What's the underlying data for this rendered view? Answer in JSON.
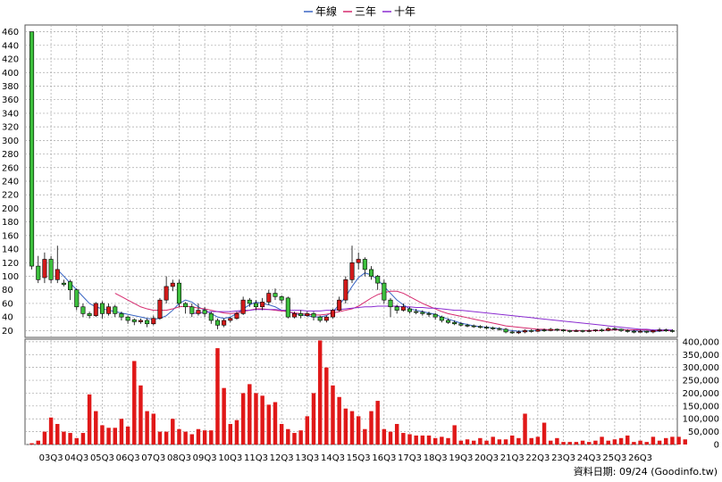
{
  "chart_data": {
    "type": "candlestick+bar",
    "legend": [
      {
        "label": "年線",
        "color": "#3a66c4"
      },
      {
        "label": "三年",
        "color": "#d62a6e"
      },
      {
        "label": "十年",
        "color": "#8a2bd0"
      }
    ],
    "price_axis": {
      "ticks": [
        20,
        40,
        60,
        80,
        100,
        120,
        140,
        160,
        180,
        200,
        220,
        240,
        260,
        280,
        300,
        320,
        340,
        360,
        380,
        400,
        420,
        440,
        460
      ],
      "ylim": [
        10,
        470
      ]
    },
    "volume_axis": {
      "tick_labels": [
        "400,000",
        "350,000",
        "300,000",
        "250,000",
        "200,000",
        "150,000",
        "100,000",
        "50,000",
        "0"
      ],
      "ylim": [
        0,
        410000
      ]
    },
    "x_tick_labels": [
      "03Q3",
      "04Q3",
      "05Q3",
      "06Q3",
      "07Q3",
      "08Q3",
      "09Q3",
      "10Q3",
      "11Q3",
      "12Q3",
      "13Q3",
      "14Q3",
      "15Q3",
      "16Q3",
      "17Q3",
      "18Q3",
      "19Q3",
      "20Q3",
      "21Q3",
      "22Q3",
      "23Q3",
      "24Q3",
      "25Q3",
      "26Q3"
    ],
    "x_tick_start_index": 3,
    "candles": [
      [
        460,
        115,
        460,
        110
      ],
      [
        115,
        95,
        130,
        90
      ],
      [
        98,
        125,
        135,
        90
      ],
      [
        125,
        95,
        130,
        90
      ],
      [
        95,
        110,
        145,
        90
      ],
      [
        90,
        88,
        95,
        85
      ],
      [
        92,
        80,
        95,
        65
      ],
      [
        80,
        55,
        82,
        50
      ],
      [
        55,
        45,
        60,
        40
      ],
      [
        45,
        42,
        48,
        38
      ],
      [
        42,
        60,
        62,
        40
      ],
      [
        60,
        45,
        63,
        38
      ],
      [
        45,
        55,
        60,
        42
      ],
      [
        55,
        45,
        58,
        40
      ],
      [
        45,
        40,
        48,
        35
      ],
      [
        40,
        35,
        42,
        30
      ],
      [
        36,
        33,
        38,
        28
      ],
      [
        33,
        35,
        38,
        30
      ],
      [
        35,
        30,
        38,
        25
      ],
      [
        30,
        38,
        42,
        28
      ],
      [
        38,
        65,
        68,
        36
      ],
      [
        65,
        85,
        100,
        60
      ],
      [
        85,
        90,
        95,
        78
      ],
      [
        90,
        60,
        95,
        55
      ],
      [
        60,
        55,
        62,
        45
      ],
      [
        55,
        45,
        60,
        40
      ],
      [
        45,
        50,
        60,
        42
      ],
      [
        50,
        45,
        55,
        40
      ],
      [
        45,
        35,
        48,
        30
      ],
      [
        35,
        28,
        38,
        22
      ],
      [
        28,
        35,
        38,
        25
      ],
      [
        35,
        38,
        40,
        32
      ],
      [
        38,
        45,
        48,
        36
      ],
      [
        45,
        65,
        70,
        43
      ],
      [
        65,
        60,
        68,
        55
      ],
      [
        60,
        55,
        65,
        50
      ],
      [
        55,
        62,
        68,
        50
      ],
      [
        62,
        75,
        80,
        58
      ],
      [
        75,
        70,
        82,
        65
      ],
      [
        70,
        65,
        72,
        60
      ],
      [
        68,
        40,
        70,
        38
      ],
      [
        40,
        45,
        48,
        38
      ],
      [
        45,
        42,
        50,
        38
      ],
      [
        42,
        45,
        48,
        40
      ],
      [
        45,
        40,
        48,
        35
      ],
      [
        40,
        35,
        42,
        32
      ],
      [
        35,
        40,
        42,
        32
      ],
      [
        40,
        50,
        52,
        38
      ],
      [
        50,
        65,
        70,
        48
      ],
      [
        65,
        95,
        100,
        60
      ],
      [
        95,
        120,
        145,
        90
      ],
      [
        120,
        125,
        135,
        110
      ],
      [
        125,
        110,
        128,
        100
      ],
      [
        110,
        100,
        115,
        95
      ],
      [
        100,
        90,
        102,
        80
      ],
      [
        90,
        65,
        95,
        60
      ],
      [
        65,
        55,
        68,
        40
      ],
      [
        55,
        50,
        58,
        45
      ],
      [
        50,
        55,
        60,
        48
      ],
      [
        52,
        48,
        55,
        45
      ],
      [
        48,
        47,
        52,
        44
      ],
      [
        47,
        45,
        50,
        42
      ],
      [
        45,
        44,
        48,
        40
      ],
      [
        44,
        40,
        46,
        36
      ],
      [
        40,
        35,
        42,
        32
      ],
      [
        35,
        32,
        38,
        30
      ],
      [
        32,
        30,
        35,
        28
      ],
      [
        30,
        28,
        32,
        26
      ],
      [
        28,
        27,
        30,
        25
      ],
      [
        27,
        26,
        29,
        24
      ],
      [
        26,
        25,
        28,
        23
      ],
      [
        25,
        24,
        27,
        22
      ],
      [
        24,
        23,
        26,
        21
      ],
      [
        23,
        22,
        25,
        20
      ],
      [
        22,
        18,
        24,
        16
      ],
      [
        18,
        17,
        20,
        15
      ],
      [
        17,
        18,
        20,
        15
      ],
      [
        18,
        20,
        22,
        16
      ],
      [
        20,
        19,
        22,
        17
      ],
      [
        19,
        21,
        23,
        18
      ],
      [
        21,
        20,
        23,
        18
      ],
      [
        20,
        22,
        24,
        19
      ],
      [
        22,
        21,
        23,
        19
      ],
      [
        21,
        20,
        22,
        18
      ],
      [
        20,
        19,
        21,
        17
      ],
      [
        19,
        20,
        22,
        18
      ],
      [
        20,
        19,
        21,
        17
      ],
      [
        19,
        20,
        22,
        18
      ],
      [
        20,
        21,
        22,
        18
      ],
      [
        21,
        20,
        23,
        18
      ],
      [
        20,
        23,
        25,
        19
      ],
      [
        23,
        22,
        25,
        20
      ],
      [
        22,
        20,
        23,
        18
      ],
      [
        20,
        19,
        22,
        17
      ],
      [
        19,
        18,
        21,
        16
      ],
      [
        18,
        19,
        21,
        17
      ],
      [
        19,
        18,
        20,
        16
      ],
      [
        18,
        20,
        21,
        16
      ],
      [
        20,
        21,
        24,
        18
      ],
      [
        21,
        20,
        23,
        18
      ],
      [
        20,
        19,
        22,
        17
      ]
    ],
    "volumes": [
      5000,
      15000,
      50000,
      105000,
      80000,
      50000,
      45000,
      25000,
      45000,
      195000,
      130000,
      75000,
      65000,
      65000,
      100000,
      70000,
      325000,
      230000,
      130000,
      120000,
      50000,
      50000,
      100000,
      60000,
      50000,
      40000,
      60000,
      55000,
      55000,
      375000,
      220000,
      80000,
      95000,
      200000,
      235000,
      200000,
      190000,
      155000,
      165000,
      80000,
      60000,
      45000,
      55000,
      110000,
      200000,
      405000,
      300000,
      230000,
      185000,
      140000,
      130000,
      110000,
      60000,
      130000,
      170000,
      60000,
      50000,
      80000,
      45000,
      40000,
      35000,
      35000,
      35000,
      25000,
      30000,
      25000,
      75000,
      15000,
      20000,
      15000,
      25000,
      15000,
      30000,
      20000,
      20000,
      35000,
      25000,
      120000,
      25000,
      30000,
      85000,
      15000,
      25000,
      10000,
      10000,
      10000,
      15000,
      10000,
      15000,
      30000,
      15000,
      20000,
      25000,
      35000,
      10000,
      15000,
      10000,
      30000,
      15000,
      25000,
      30000,
      30000,
      20000
    ],
    "ma_year": [
      null,
      null,
      null,
      null,
      110,
      100,
      90,
      80,
      70,
      60,
      55,
      52,
      50,
      48,
      46,
      44,
      42,
      40,
      38,
      37,
      38,
      42,
      50,
      60,
      65,
      62,
      55,
      50,
      45,
      40,
      38,
      40,
      45,
      52,
      58,
      62,
      60,
      58,
      55,
      50,
      48,
      45,
      43,
      42,
      40,
      40,
      42,
      48,
      58,
      70,
      85,
      98,
      105,
      102,
      95,
      85,
      75,
      65,
      58,
      52,
      50,
      48,
      46,
      44,
      40,
      37,
      34,
      31,
      29,
      27,
      26,
      25,
      24,
      23,
      21,
      20,
      19,
      19,
      20,
      20,
      21,
      21,
      21,
      21,
      20,
      20,
      20,
      20,
      20,
      20,
      21,
      22,
      22,
      21,
      20,
      19,
      19,
      19,
      19,
      20,
      20
    ],
    "ma_3y": [
      null,
      null,
      null,
      null,
      null,
      null,
      null,
      null,
      null,
      null,
      null,
      null,
      null,
      75,
      70,
      65,
      60,
      55,
      52,
      50,
      50,
      50,
      52,
      55,
      56,
      55,
      53,
      52,
      50,
      48,
      46,
      45,
      46,
      48,
      50,
      52,
      52,
      51,
      50,
      49,
      48,
      46,
      45,
      44,
      43,
      43,
      44,
      46,
      48,
      50,
      52,
      56,
      62,
      68,
      73,
      76,
      78,
      78,
      75,
      70,
      65,
      60,
      56,
      52,
      48,
      45,
      43,
      41,
      39,
      37,
      35,
      33,
      31,
      29,
      27,
      26,
      25,
      24,
      23,
      22,
      22,
      21,
      21,
      21,
      20,
      20,
      20,
      20,
      20,
      20,
      21,
      21,
      21,
      21,
      21,
      21,
      21,
      20,
      20,
      20,
      20
    ],
    "ma_10y": [
      null,
      null,
      null,
      null,
      null,
      null,
      null,
      null,
      null,
      null,
      null,
      null,
      null,
      null,
      null,
      null,
      null,
      null,
      null,
      null,
      null,
      null,
      null,
      null,
      null,
      45,
      46,
      47,
      48,
      48,
      48,
      48,
      49,
      50,
      50,
      51,
      51,
      51,
      51,
      50,
      50,
      50,
      50,
      49,
      49,
      49,
      50,
      50,
      51,
      52,
      53,
      54,
      55,
      55,
      56,
      56,
      56,
      56,
      55,
      55,
      54,
      54,
      53,
      53,
      52,
      51,
      50,
      50,
      49,
      48,
      47,
      46,
      45,
      44,
      43,
      42,
      41,
      40,
      39,
      38,
      37,
      36,
      35,
      34,
      33,
      32,
      31,
      30,
      29,
      28,
      27,
      26,
      25,
      24,
      23,
      22,
      22,
      21,
      21,
      21,
      21
    ],
    "colors": {
      "up": "#d21a1a",
      "down": "#3cbf3c",
      "volume": "#e01818",
      "grid": "#a6a6a6"
    },
    "credit": "資料日期: 09/24  (Goodinfo.tw)"
  }
}
